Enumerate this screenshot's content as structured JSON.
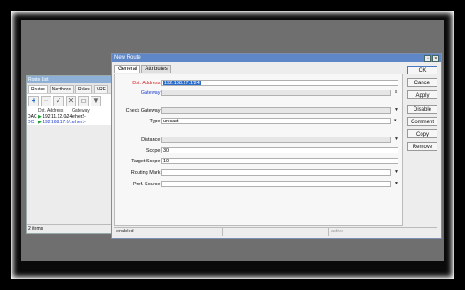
{
  "route_list": {
    "title": "Route List",
    "tabs": [
      "Routes",
      "Nexthops",
      "Rules",
      "VRF"
    ],
    "columns": [
      "",
      "Dst. Address",
      "Gateway"
    ],
    "rows": [
      {
        "flags": "DAC",
        "dst": "192.11.12.0/24",
        "gateway": "ether2-"
      },
      {
        "flags": "DC",
        "dst": "192.168.17.0/...",
        "gateway": "ether1-"
      }
    ],
    "footer": "2 items"
  },
  "new_route": {
    "title": "New Route",
    "tabs": [
      "General",
      "Attributes"
    ],
    "fields": {
      "dst_address": {
        "label": "Dst. Address:",
        "value": "192.168.17.1/24"
      },
      "gateway": {
        "label": "Gateway:",
        "value": ""
      },
      "check_gateway": {
        "label": "Check Gateway:",
        "value": ""
      },
      "type": {
        "label": "Type:",
        "value": "unicast"
      },
      "distance": {
        "label": "Distance:",
        "value": ""
      },
      "scope": {
        "label": "Scope:",
        "value": "30"
      },
      "target_scope": {
        "label": "Target Scope:",
        "value": "10"
      },
      "routing_mark": {
        "label": "Routing Mark:",
        "value": ""
      },
      "pref_source": {
        "label": "Pref. Source:",
        "value": ""
      }
    },
    "buttons": {
      "ok": "OK",
      "cancel": "Cancel",
      "apply": "Apply",
      "disable": "Disable",
      "comment": "Comment",
      "copy": "Copy",
      "remove": "Remove"
    },
    "status": {
      "left": "enabled",
      "right": "active"
    }
  },
  "colors": {
    "accent": "#5f86c6",
    "dst_label": "#d42020",
    "selection": "#2a6ccc"
  }
}
